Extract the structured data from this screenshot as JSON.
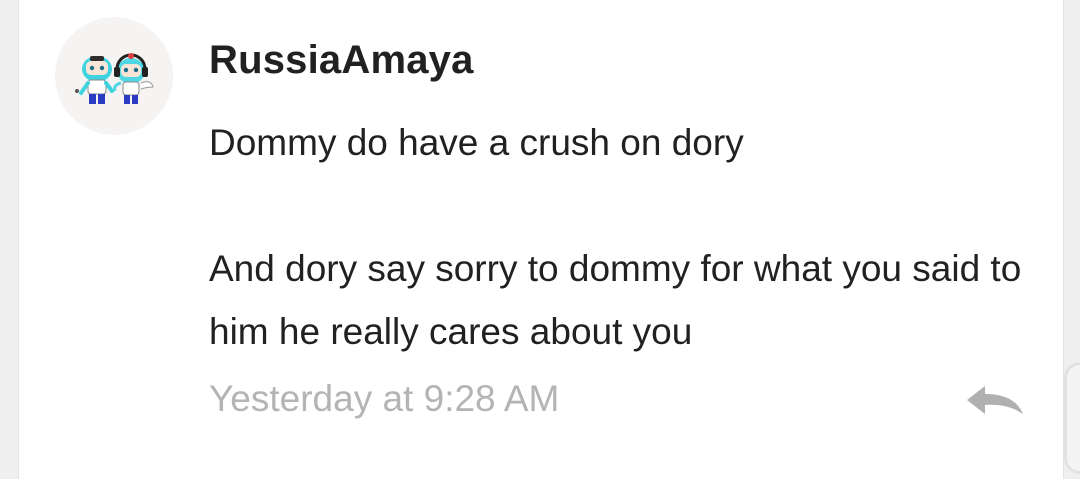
{
  "comment": {
    "username": "RussiaAmaya",
    "avatar_icon": "avatar-chibi-characters",
    "message_lines": [
      "Dommy do have a crush on dory",
      "",
      "And dory say sorry to dommy for what you said to him he really cares about you"
    ],
    "timestamp": "Yesterday at 9:28 AM",
    "reply_icon": "reply-arrow-icon"
  },
  "colors": {
    "text": "#212121",
    "timestamp": "#b4b4b4",
    "icon": "#b0b0b0",
    "background": "#ffffff"
  }
}
